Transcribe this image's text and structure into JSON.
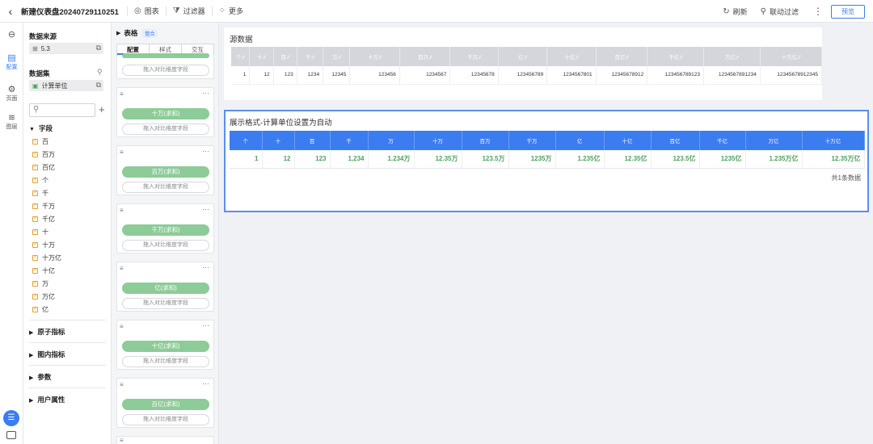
{
  "topbar": {
    "title": "新建仪表盘20240729110251",
    "chart_label": "图表",
    "filter_label": "过滤器",
    "more_label": "更多",
    "refresh_label": "刷新",
    "link_filter_label": "联动过滤",
    "preview_label": "预览"
  },
  "rail": {
    "config_label": "配置",
    "page_label": "页面",
    "layer_label": "图层"
  },
  "datapanel": {
    "source_heading": "数据来源",
    "source_value": "5.3",
    "dataset_heading": "数据集",
    "dataset_value": "计算单位",
    "fields_heading": "字段",
    "fields": [
      "百",
      "百万",
      "百亿",
      "个",
      "千",
      "千万",
      "千亿",
      "十",
      "十万",
      "十万亿",
      "十亿",
      "万",
      "万亿",
      "亿"
    ],
    "sections": [
      "原子指标",
      "图内指标",
      "参数",
      "用户属性"
    ]
  },
  "config": {
    "heading": "表格",
    "badge": "整合",
    "tabs": [
      "配置",
      "样式",
      "交互"
    ],
    "dropzone_text": "拖入对比维度字段",
    "measures": [
      "十万(求和)",
      "百万(求和)",
      "千万(求和)",
      "亿(求和)",
      "十亿(求和)",
      "百亿(求和)"
    ]
  },
  "source_table": {
    "title": "源数据",
    "headers": [
      "个",
      "十",
      "百",
      "千",
      "万",
      "十万",
      "百万",
      "千万",
      "亿",
      "十亿",
      "百亿",
      "千亿",
      "万亿",
      "十万亿"
    ],
    "row": [
      "1",
      "12",
      "123",
      "1234",
      "12345",
      "123456",
      "1234567",
      "12345678",
      "123456789",
      "1234567801",
      "12345678912",
      "123456789123",
      "1234567891234",
      "12345678912345"
    ]
  },
  "format_table": {
    "title": "展示格式-计算单位设置为自动",
    "headers": [
      "个",
      "十",
      "百",
      "千",
      "万",
      "十万",
      "百万",
      "千万",
      "亿",
      "十亿",
      "百亿",
      "千亿",
      "万亿",
      "十万亿"
    ],
    "row": [
      "1",
      "12",
      "123",
      "1,234",
      "1.234万",
      "12.35万",
      "123.5万",
      "1235万",
      "1.235亿",
      "12.35亿",
      "123.5亿",
      "1235亿",
      "1.235万亿",
      "12.35万亿"
    ],
    "count_text": "共1条数据"
  }
}
